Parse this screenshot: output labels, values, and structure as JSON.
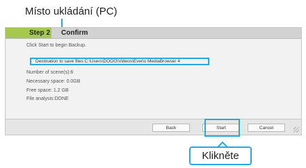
{
  "annotations": {
    "storage_location": "Místo ukládání (PC)",
    "click": "Klikněte"
  },
  "wizard": {
    "tabs": [
      {
        "label": "Step 2",
        "active": true
      },
      {
        "label": "Confirm",
        "active": false
      }
    ],
    "lines": [
      "Click Start to begin Backup.",
      "Destination to save files:C:\\Users\\DOOO\\Videos\\Everio MediaBrowser 4",
      "Number of scene(s):6",
      "Necessary space:  0.0GB",
      "Free space: 1.2 GB",
      "File analysis:DONE"
    ],
    "buttons": {
      "back": "Back",
      "start": "Start",
      "cancel": "Cancel"
    }
  },
  "colors": {
    "accent": "#29a9e0",
    "active_tab": "#a7c850"
  }
}
